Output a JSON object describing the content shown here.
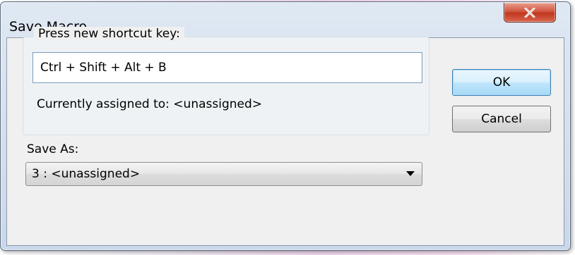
{
  "window": {
    "title": "Save Macro",
    "close_icon": "close-x-icon"
  },
  "shortcut_group": {
    "label": "Press new shortcut key:",
    "input_value": "Ctrl + Shift + Alt + B",
    "assigned_text": "Currently assigned to: <unassigned>"
  },
  "save_as": {
    "label": "Save As:",
    "selected_value": "3 : <unassigned>",
    "dropdown_icon": "chevron-down-icon"
  },
  "buttons": {
    "ok_label": "OK",
    "cancel_label": "Cancel"
  },
  "colors": {
    "close_button": "#c9452c",
    "default_button": "#bee6fd"
  }
}
